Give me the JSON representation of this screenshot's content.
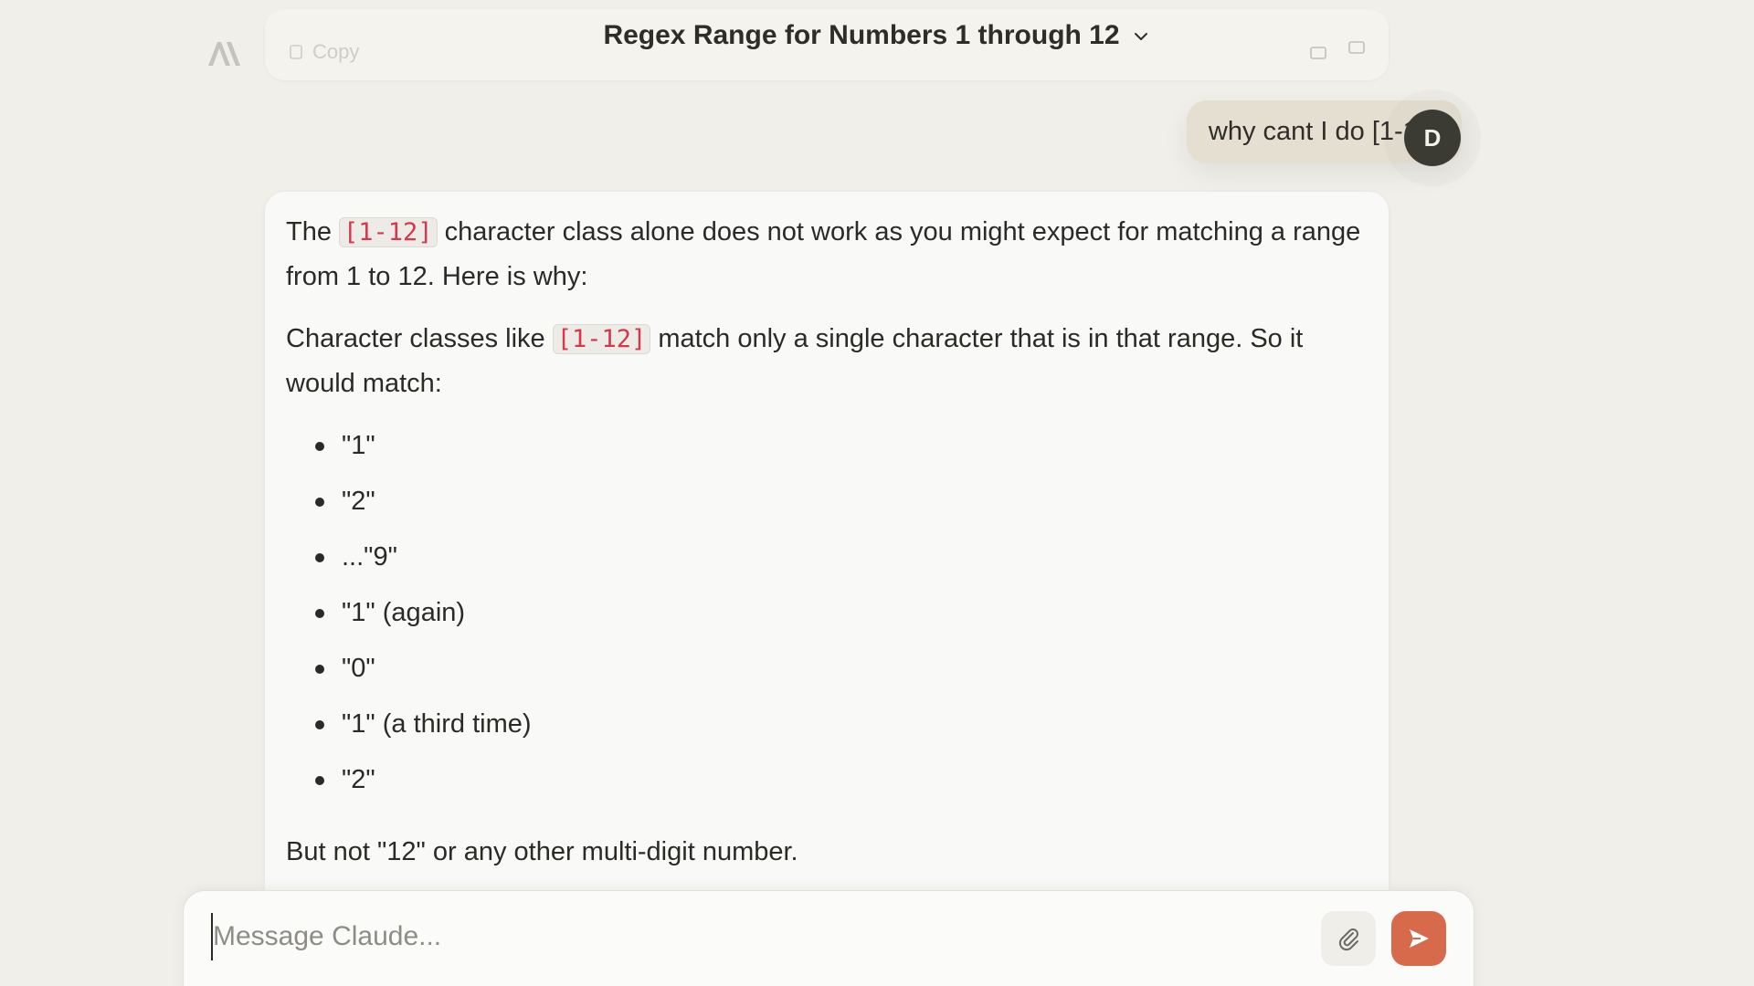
{
  "header": {
    "title": "Regex Range for Numbers 1 through 12",
    "dropdown_icon": "chevron-down-icon"
  },
  "previous_message": {
    "copy_label": "Copy"
  },
  "user_message": {
    "text": "why cant I do [1-12]",
    "avatar_initial": "D"
  },
  "assistant_message": {
    "p1_before": "The ",
    "p1_code": "[1-12]",
    "p1_after": " character class alone does not work as you might expect for matching a range from 1 to 12. Here is why:",
    "p2_before": "Character classes like ",
    "p2_code": "[1-12]",
    "p2_after": " match only a single character that is in that range. So it would match:",
    "bullets": [
      "\"1\"",
      "\"2\"",
      "...\"9\"",
      "\"1\" (again)",
      "\"0\"",
      "\"1\" (a third time)",
      "\"2\""
    ],
    "p3": "But not \"12\" or any other multi-digit number."
  },
  "composer": {
    "placeholder": "Message Claude...",
    "attach_icon": "paperclip-icon",
    "send_icon": "send-icon"
  },
  "colors": {
    "background": "#f0efe9",
    "card": "#f9f9f7",
    "user_bubble": "#e5dfd1",
    "avatar": "#3b3b34",
    "send_button": "#d66a4b",
    "code_text": "#d4374e"
  }
}
